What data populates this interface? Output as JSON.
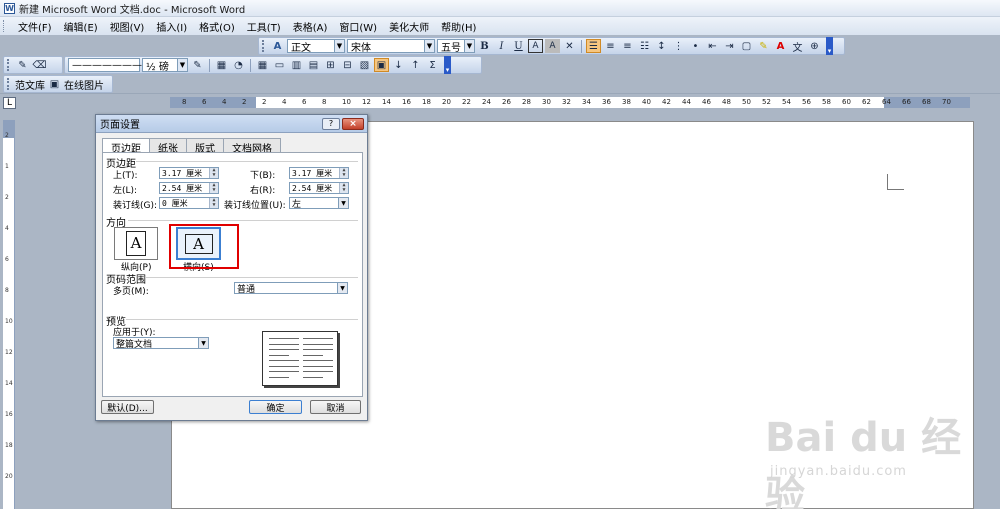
{
  "window": {
    "title": "新建 Microsoft Word 文档.doc - Microsoft Word",
    "icon": "word-doc-icon"
  },
  "menu": [
    "文件(F)",
    "编辑(E)",
    "视图(V)",
    "插入(I)",
    "格式(O)",
    "工具(T)",
    "表格(A)",
    "窗口(W)",
    "美化大师",
    "帮助(H)"
  ],
  "formatting": {
    "style": "正文",
    "font": "宋体",
    "size": "五号",
    "style_icon": "styles-pane-icon",
    "buttons": [
      "B",
      "I",
      "U",
      "A",
      "A"
    ]
  },
  "toolbar2": {
    "line_style": "———————",
    "line_weight": "½ 磅"
  },
  "toolbar3": {
    "items": [
      "范文库",
      "在线图片"
    ]
  },
  "ruler": {
    "corner": "L",
    "numbers": [
      "8",
      "6",
      "4",
      "2",
      "2",
      "4",
      "6",
      "8",
      "10",
      "12",
      "14",
      "16",
      "18",
      "20",
      "22",
      "24",
      "26",
      "28",
      "30",
      "32",
      "34",
      "36",
      "38",
      "40",
      "42",
      "44",
      "46",
      "48",
      "50",
      "52",
      "54",
      "56",
      "58",
      "60",
      "62",
      "64",
      "66",
      "68",
      "70"
    ],
    "vnumbers": [
      "2",
      "1",
      "2",
      "4",
      "6",
      "8",
      "10",
      "12",
      "14",
      "16",
      "18",
      "20"
    ]
  },
  "dialog": {
    "title": "页面设置",
    "tabs": [
      "页边距",
      "纸张",
      "版式",
      "文档网格"
    ],
    "margins_section": "页边距",
    "top_label": "上(T):",
    "top_value": "3.17 厘米",
    "bottom_label": "下(B):",
    "bottom_value": "3.17 厘米",
    "left_label": "左(L):",
    "left_value": "2.54 厘米",
    "right_label": "右(R):",
    "right_value": "2.54 厘米",
    "gutter_label": "装订线(G):",
    "gutter_value": "0 厘米",
    "gutter_pos_label": "装订线位置(U):",
    "gutter_pos_value": "左",
    "orientation_section": "方向",
    "portrait_label": "纵向(P)",
    "landscape_label": "横向(S)",
    "orientation_glyph": "A",
    "pages_section": "页码范围",
    "multiple_pages_label": "多页(M):",
    "multiple_pages_value": "普通",
    "preview_section": "预览",
    "apply_to_label": "应用于(Y):",
    "apply_to_value": "整篇文档",
    "default_button": "默认(D)...",
    "ok_button": "确定",
    "cancel_button": "取消",
    "help_button": "?",
    "close_button": "×"
  },
  "watermark": {
    "brand": "Bai du 经验",
    "url": "jingyan.baidu.com"
  }
}
